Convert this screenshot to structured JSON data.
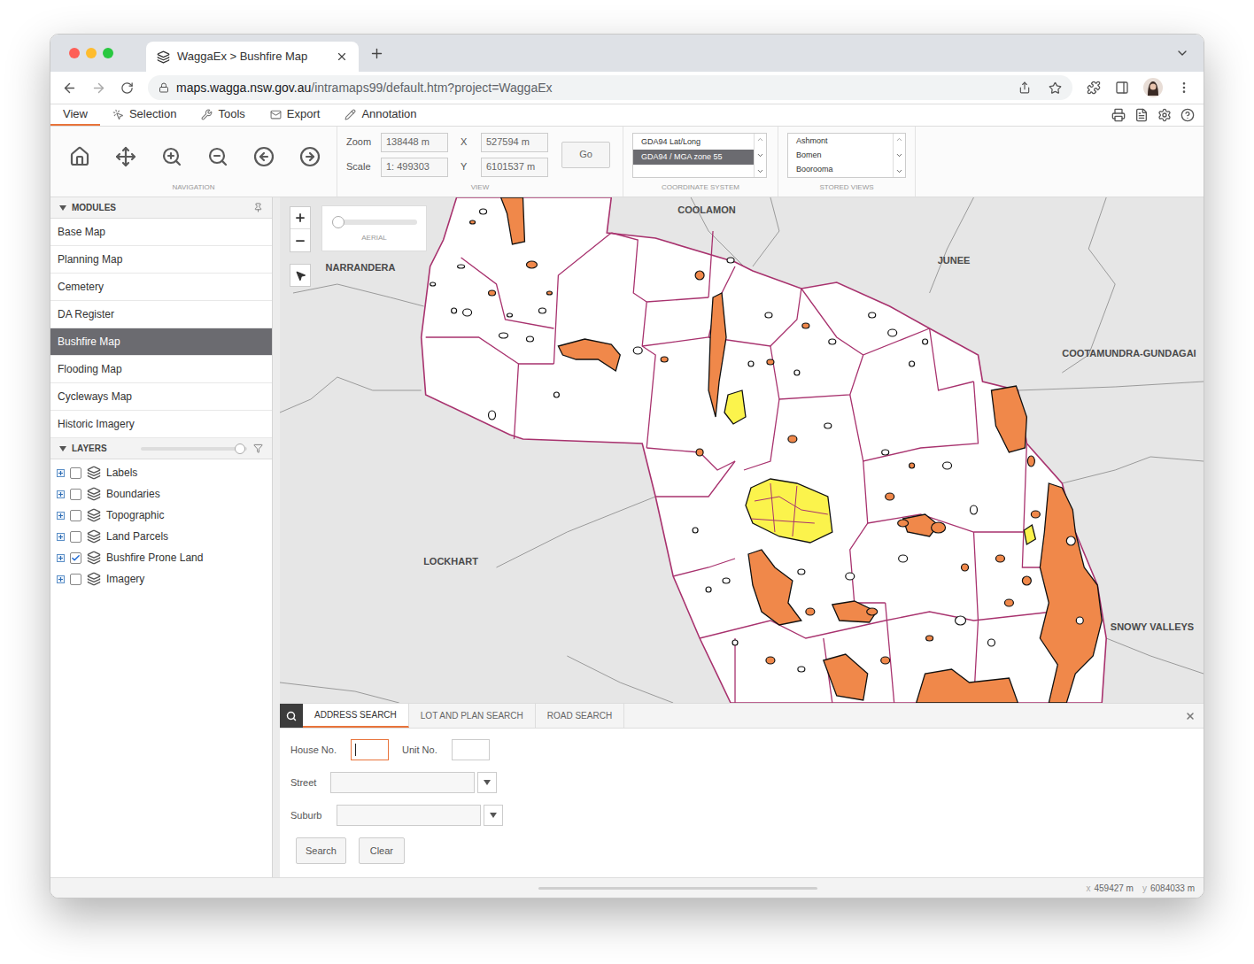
{
  "browser": {
    "tab_title": "WaggaEx > Bushfire Map",
    "url_host": "maps.wagga.nsw.gov.au",
    "url_path": "/intramaps99/default.htm?project=WaggaEx"
  },
  "menu": [
    {
      "label": "View",
      "selected": true
    },
    {
      "label": "Selection",
      "selected": false
    },
    {
      "label": "Tools",
      "selected": false
    },
    {
      "label": "Export",
      "selected": false
    },
    {
      "label": "Annotation",
      "selected": false
    }
  ],
  "ribbon": {
    "navigation_label": "NAVIGATION",
    "view": {
      "label": "VIEW",
      "zoom_label": "Zoom",
      "zoom": "138448 m",
      "scale_label": "Scale",
      "scale": "1: 499303",
      "x_label": "X",
      "x": "527594 m",
      "y_label": "Y",
      "y": "6101537 m",
      "go": "Go"
    },
    "coordinate_system": {
      "label": "COORDINATE SYSTEM",
      "options": [
        {
          "label": "GDA94 Lat/Long",
          "selected": false
        },
        {
          "label": "GDA94 / MGA zone 55",
          "selected": true
        }
      ]
    },
    "stored_views": {
      "label": "STORED VIEWS",
      "items": [
        "Ashmont",
        "Bomen",
        "Boorooma"
      ]
    }
  },
  "modules": {
    "title": "MODULES",
    "items": [
      {
        "label": "Base Map",
        "selected": false
      },
      {
        "label": "Planning Map",
        "selected": false
      },
      {
        "label": "Cemetery",
        "selected": false
      },
      {
        "label": "DA Register",
        "selected": false
      },
      {
        "label": "Bushfire Map",
        "selected": true
      },
      {
        "label": "Flooding Map",
        "selected": false
      },
      {
        "label": "Cycleways Map",
        "selected": false
      },
      {
        "label": "Historic Imagery",
        "selected": false
      }
    ]
  },
  "layers": {
    "title": "LAYERS",
    "opacity_level": 0.93,
    "items": [
      {
        "label": "Labels",
        "checked": false
      },
      {
        "label": "Boundaries",
        "checked": false
      },
      {
        "label": "Topographic",
        "checked": false
      },
      {
        "label": "Land Parcels",
        "checked": false
      },
      {
        "label": "Bushfire Prone Land",
        "checked": true
      },
      {
        "label": "Imagery",
        "checked": false
      }
    ]
  },
  "map": {
    "aerial_label": "AERIAL",
    "aerial_level": 0,
    "place_labels": [
      "COOLAMON",
      "NARRANDERA",
      "JUNEE",
      "COOTAMUNDRA-GUNDAGAI",
      "LOCKHART",
      "SNOWY VALLEYS"
    ]
  },
  "search": {
    "tabs": [
      {
        "label": "ADDRESS SEARCH",
        "selected": true
      },
      {
        "label": "LOT AND PLAN SEARCH",
        "selected": false
      },
      {
        "label": "ROAD SEARCH",
        "selected": false
      }
    ],
    "fields": [
      {
        "label": "House No.",
        "kind": "text",
        "focused": true
      },
      {
        "label": "Unit No.",
        "kind": "text",
        "focused": false
      },
      {
        "label": "Street",
        "kind": "combo",
        "focused": false
      },
      {
        "label": "Suburb",
        "kind": "combo",
        "focused": false
      }
    ],
    "buttons": [
      "Search",
      "Clear"
    ]
  },
  "status_bar": {
    "x_label": "x",
    "x": "459427 m",
    "y_label": "y",
    "y": "6084033 m"
  }
}
